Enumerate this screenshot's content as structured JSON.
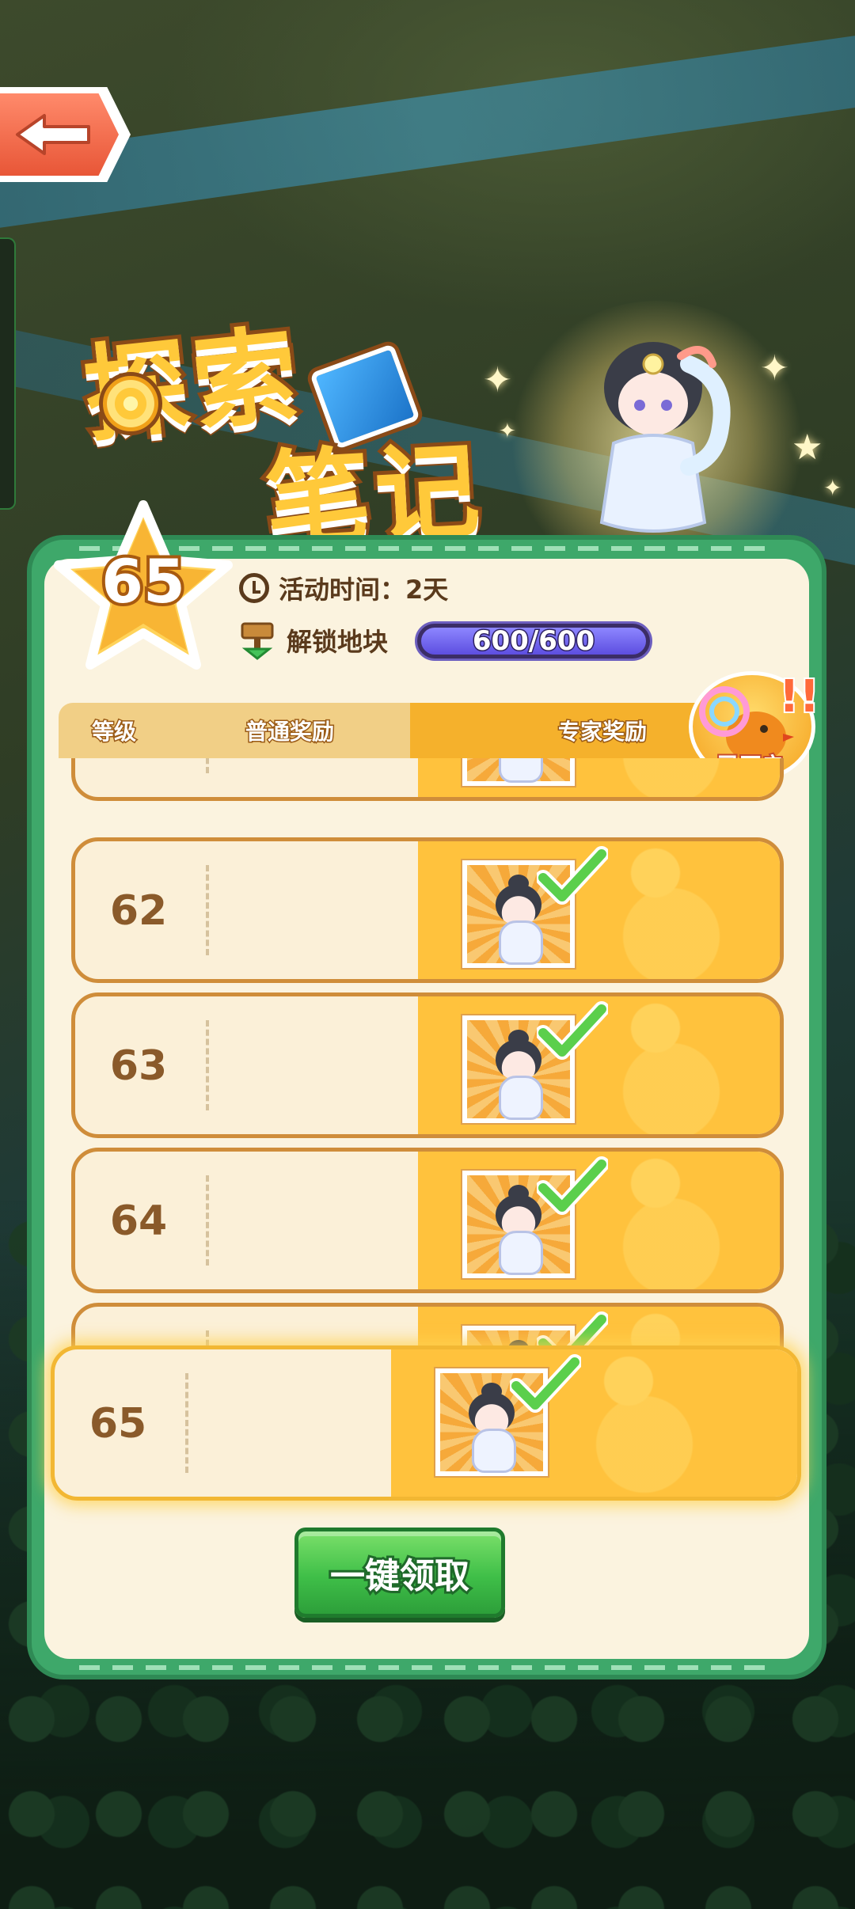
{
  "game": {
    "title_line1": "探索",
    "title_line2": "笔记"
  },
  "header": {
    "level": "65",
    "activity_time_label": "活动时间：2天",
    "unlock_label": "解锁地块",
    "unlock_progress_text": "600/600",
    "unlock_progress_value": 600,
    "unlock_progress_max": 600
  },
  "table": {
    "col_level": "等级",
    "col_normal": "普通奖励",
    "col_expert": "专家奖励",
    "expert_status_badge": "已开启",
    "rows": [
      {
        "level": "",
        "claimed": true
      },
      {
        "level": "62",
        "claimed": true
      },
      {
        "level": "63",
        "claimed": true
      },
      {
        "level": "64",
        "claimed": true
      },
      {
        "level": "",
        "claimed": true
      },
      {
        "level": "65",
        "claimed": true,
        "current": true
      }
    ]
  },
  "actions": {
    "claim_all_label": "一键领取"
  },
  "colors": {
    "panel_green": "#3ea86a",
    "expert_gold": "#ffc23d",
    "claim_green": "#3fbf48",
    "progress_purple": "#5d4ee0"
  },
  "icons": {
    "back": "arrow-left-icon",
    "clock": "clock-icon",
    "unlock": "signpost-icon",
    "check": "checkmark-icon",
    "star": "star-icon"
  }
}
